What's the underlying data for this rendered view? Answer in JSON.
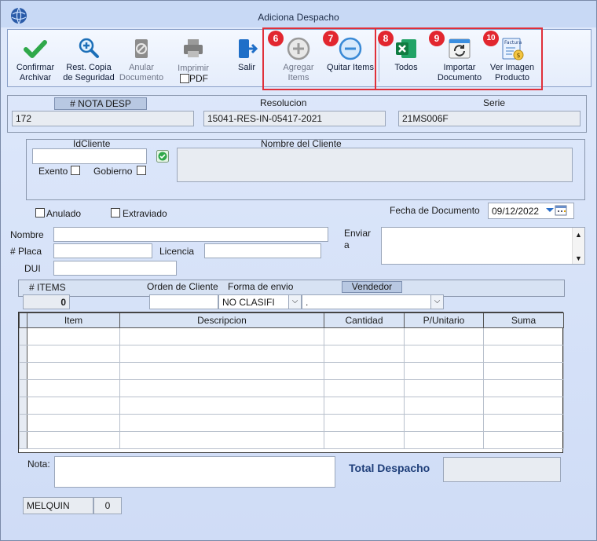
{
  "window": {
    "title": "Adiciona Despacho"
  },
  "toolbar": {
    "confirm": "Confirmar Archivar",
    "restore": "Rest. Copia de Seguridad",
    "cancel_doc": "Anular Documento",
    "print": "Imprimir",
    "pdf": "PDF",
    "exit": "Salir",
    "add_items": "Agregar Items",
    "remove_items": "Quitar Items",
    "all": "Todos",
    "import": "Importar Documento",
    "view_image": "Ver Imagen Producto"
  },
  "badges": [
    "6",
    "7",
    "8",
    "9",
    "10"
  ],
  "header": {
    "nota_label": "# NOTA DESP",
    "nota_value": "172",
    "resolucion_label": "Resolucion",
    "resolucion_value": "15041-RES-IN-05417-2021",
    "serie_label": "Serie",
    "serie_value": "21MS006F"
  },
  "client": {
    "id_label": "IdCliente",
    "id_value": "",
    "name_label": "Nombre del Cliente",
    "name_value": "",
    "exento_label": "Exento",
    "gobierno_label": "Gobierno"
  },
  "status": {
    "anulado_label": "Anulado",
    "extraviado_label": "Extraviado",
    "fecha_label": "Fecha de Documento",
    "fecha_value": "09/12/2022"
  },
  "shipping": {
    "nombre_label": "Nombre",
    "placa_label": "# Placa",
    "licencia_label": "Licencia",
    "dui_label": "DUI",
    "enviar_label": "Enviar a"
  },
  "items_bar": {
    "items_label": "# ITEMS",
    "items_value": "0",
    "orden_label": "Orden de Cliente",
    "forma_label": "Forma de envio",
    "forma_value": "NO CLASIFI",
    "vendedor_label": "Vendedor",
    "vendedor_value": "."
  },
  "table": {
    "columns": [
      "Item",
      "Descripcion",
      "Cantidad",
      "P/Unitario",
      "Suma"
    ],
    "rows": 7
  },
  "footer": {
    "nota_label": "Nota:",
    "total_label": "Total Despacho",
    "total_value": "",
    "user": "MELQUIN",
    "user_count": "0"
  },
  "colors": {
    "highlight": "#e0303a",
    "accent": "#1f3f7a"
  }
}
